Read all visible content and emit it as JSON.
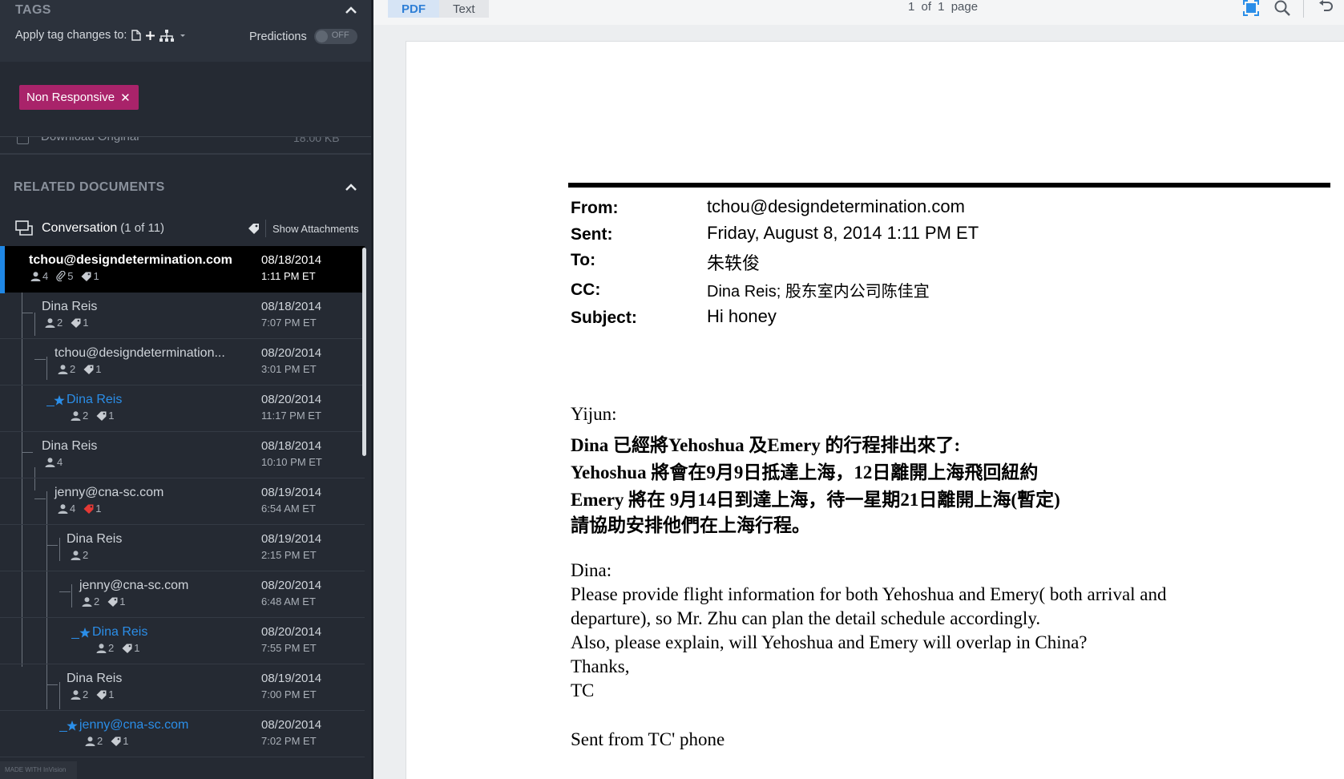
{
  "left": {
    "tags": {
      "title": "TAGS",
      "apply_label": "Apply tag changes to:",
      "predictions_label": "Predictions",
      "toggle_text": "OFF",
      "chip_label": "Non Responsive",
      "chip_remove": "✕"
    },
    "download": {
      "label": "Download Original",
      "size": "18.00 KB"
    },
    "related": {
      "title": "RELATED DOCUMENTS",
      "conversation_label": "Conversation",
      "conversation_count": "(1 of 11)",
      "show_attachments": "Show Attachments"
    },
    "rows": [
      {
        "name": "tchou@designdetermination.com",
        "date": "08/18/2014",
        "time": "1:11 PM ET",
        "people": "4",
        "attach": "5",
        "tags": "1"
      },
      {
        "name": "Dina Reis",
        "date": "08/18/2014",
        "time": "7:07 PM ET",
        "people": "2",
        "tags": "1"
      },
      {
        "name": "tchou@designdetermination...",
        "date": "08/20/2014",
        "time": "3:01 PM ET",
        "people": "2",
        "tags": "1"
      },
      {
        "name": "Dina Reis",
        "date": "08/20/2014",
        "time": "11:17 PM ET",
        "people": "2",
        "tags": "1"
      },
      {
        "name": "Dina Reis",
        "date": "08/18/2014",
        "time": "10:10 PM ET",
        "people": "4"
      },
      {
        "name": "jenny@cna-sc.com",
        "date": "08/19/2014",
        "time": "6:54 AM ET",
        "people": "4",
        "tags": "1"
      },
      {
        "name": "Dina Reis",
        "date": "08/19/2014",
        "time": "2:15 PM ET",
        "people": "2"
      },
      {
        "name": "jenny@cna-sc.com",
        "date": "08/20/2014",
        "time": "6:48 AM ET",
        "people": "2",
        "tags": "1"
      },
      {
        "name": "Dina Reis",
        "date": "08/20/2014",
        "time": "7:55 PM ET",
        "people": "2",
        "tags": "1"
      },
      {
        "name": "Dina Reis",
        "date": "08/19/2014",
        "time": "7:00 PM ET",
        "people": "2",
        "tags": "1"
      },
      {
        "name": "jenny@cna-sc.com",
        "date": "08/20/2014",
        "time": "7:02 PM ET",
        "people": "2",
        "tags": "1"
      }
    ],
    "made_with": "MADE WITH InVision"
  },
  "viewer": {
    "tabs": [
      "PDF",
      "Text"
    ],
    "pager": "1 of 1 page",
    "email": {
      "from_label": "From:",
      "from": "tchou@designdetermination.com",
      "sent_label": "Sent:",
      "sent": "Friday, August 8, 2014  1:11 PM ET",
      "to_label": "To:",
      "to": "朱轶俊",
      "cc_label": "CC:",
      "cc": "Dina Reis; 股东室内公司陈佳宜",
      "subject_label": "Subject:",
      "subject": "Hi honey"
    },
    "body": [
      "Yijun:",
      "Dina 已經將Yehoshua 及Emery 的行程排出來了:",
      "Yehoshua 將會在9月9日抵達上海，12日離開上海飛回紐約",
      "Emery 將在 9月14日到達上海，待一星期21日離開上海(暫定)",
      "請協助安排他們在上海行程。",
      "Dina:",
      "Please provide flight information for both Yehoshua and Emery( both arrival and",
      "departure), so Mr. Zhu can plan the detail schedule accordingly.",
      "Also, please explain, will Yehoshua and Emery will overlap in China?",
      "Thanks,",
      "TC",
      "Sent from TC' phone"
    ]
  },
  "colors": {
    "accent": "#1f87e5",
    "chip": "#a9236a",
    "red_tag": "#e53935",
    "panel": "#252a33"
  }
}
